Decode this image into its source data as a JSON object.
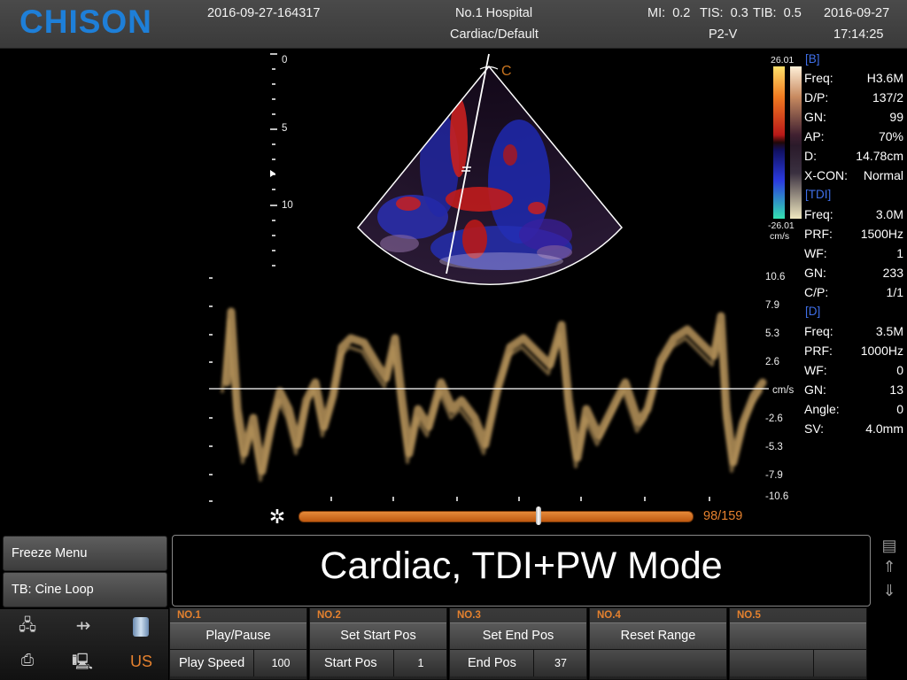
{
  "header": {
    "brand": "CHISON",
    "patient_id": "2016-09-27-164317",
    "hospital": "No.1 Hospital",
    "exam_preset": "Cardiac/Default",
    "mi": "MI:  0.2",
    "tis": "TIS:  0.3",
    "tib": "TIB:  0.5",
    "date": "2016-09-27",
    "probe": "P2-V",
    "time": "17:14:25"
  },
  "b_depth_scale": [
    "0",
    "5",
    "10"
  ],
  "focus_mark": "C",
  "color_bar": {
    "top": "26.01",
    "bottom": "-26.01",
    "unit": "cm/s"
  },
  "params": {
    "b": {
      "title": "[B]",
      "rows": [
        {
          "label": "Freq:",
          "value": "H3.6M"
        },
        {
          "label": "D/P:",
          "value": "137/2"
        },
        {
          "label": "GN:",
          "value": "99"
        },
        {
          "label": "AP:",
          "value": "70%"
        },
        {
          "label": "D:",
          "value": "14.78cm"
        },
        {
          "label": "X-CON:",
          "value": "Normal"
        }
      ]
    },
    "tdi": {
      "title": "[TDI]",
      "rows": [
        {
          "label": "Freq:",
          "value": "3.0M"
        },
        {
          "label": "PRF:",
          "value": "1500Hz"
        },
        {
          "label": "WF:",
          "value": "1"
        },
        {
          "label": "GN:",
          "value": "233"
        },
        {
          "label": "C/P:",
          "value": "1/1"
        }
      ]
    },
    "d": {
      "title": "[D]",
      "rows": [
        {
          "label": "Freq:",
          "value": "3.5M"
        },
        {
          "label": "PRF:",
          "value": "1000Hz"
        },
        {
          "label": "WF:",
          "value": "0"
        },
        {
          "label": "GN:",
          "value": "13"
        },
        {
          "label": "Angle:",
          "value": "0"
        },
        {
          "label": "SV:",
          "value": "4.0mm"
        }
      ]
    }
  },
  "doppler_scale": {
    "ticks": [
      "10.6",
      "7.9",
      "5.3",
      "2.6",
      "cm/s",
      "-2.6",
      "-5.3",
      "-7.9",
      "-10.6"
    ]
  },
  "cine": {
    "counter": "98/159",
    "position": 0.61
  },
  "left_menu": {
    "freeze_menu": "Freeze Menu",
    "tb_mode": "TB: Cine Loop"
  },
  "mode_title": "Cardiac, TDI+PW Mode",
  "status_icons": {
    "network": "network-icon",
    "usb": "usb-icon",
    "storage": "storage-icon",
    "printer": "printer-icon",
    "computer": "computer-icon",
    "us_label": "US",
    "us_color": "#e5812e"
  },
  "softkeys": [
    {
      "head": "NO.1",
      "button": "Play/Pause",
      "sub_label": "Play Speed",
      "sub_value": "100"
    },
    {
      "head": "NO.2",
      "button": "Set Start Pos",
      "sub_label": "Start Pos",
      "sub_value": "1"
    },
    {
      "head": "NO.3",
      "button": "Set End Pos",
      "sub_label": "End Pos",
      "sub_value": "37"
    },
    {
      "head": "NO.4",
      "button": "Reset Range",
      "sub_label": "",
      "sub_value": ""
    },
    {
      "head": "NO.5",
      "button": "",
      "sub_label": "",
      "sub_value": ""
    }
  ],
  "colors": {
    "brand": "#1e7fd8",
    "section": "#3f6fe8",
    "accent": "#e5812e",
    "doppler": "#c8a56a"
  }
}
